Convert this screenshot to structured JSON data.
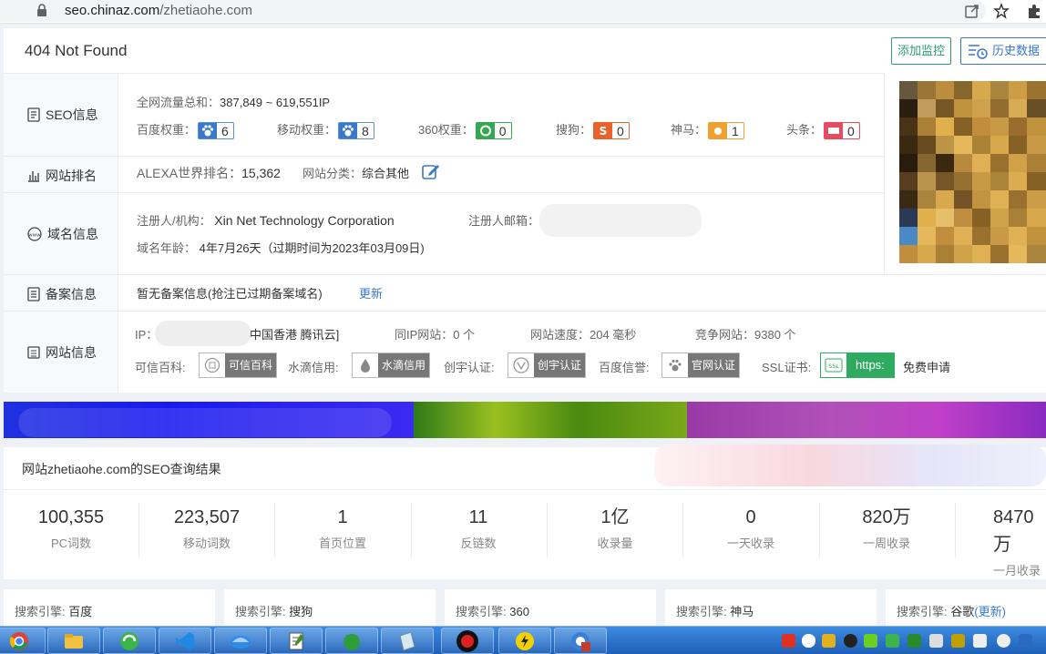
{
  "browser": {
    "url_host": "seo.chinaz.com",
    "url_path": "/zhetiaohe.com"
  },
  "header": {
    "title": "404 Not Found",
    "add_monitor": "添加监控",
    "history": "历史数据"
  },
  "seo": {
    "label": "SEO信息",
    "traffic_label": "全网流量总和：",
    "traffic_value": "387,849 ~ 619,551IP",
    "weights": [
      {
        "label": "百度权重：",
        "value": "6",
        "color": "#3a78c9"
      },
      {
        "label": "移动权重：",
        "value": "8",
        "color": "#3a78c9"
      },
      {
        "label": "360权重：",
        "value": "0",
        "color": "#34a853"
      },
      {
        "label": "搜狗：",
        "value": "0",
        "color": "#e8632b"
      },
      {
        "label": "神马：",
        "value": "1",
        "color": "#f0a030"
      },
      {
        "label": "头条：",
        "value": "0",
        "color": "#e84a5f"
      }
    ]
  },
  "ranking": {
    "label": "网站排名",
    "alexa_label": "ALEXA世界排名：",
    "alexa_value": "15,362",
    "category_label": "网站分类：",
    "category_value": "综合其他"
  },
  "domain": {
    "label": "域名信息",
    "registrant_label": "注册人/机构：",
    "registrant_value": "Xin Net Technology Corporation",
    "email_label": "注册人邮箱：",
    "age_label": "域名年龄：",
    "age_value": "4年7月26天（过期时间为2023年03月09日)"
  },
  "icp": {
    "label": "备案信息",
    "value": "暂无备案信息(抢注已过期备案域名)",
    "update": "更新"
  },
  "site": {
    "label": "网站信息",
    "ip_label": "IP：",
    "ip_location": "中国香港 腾讯云]",
    "same_ip": "同IP网站：0 个",
    "speed": "网站速度：204 毫秒",
    "competitors": "竞争网站：9380 个",
    "certs": [
      {
        "label": "可信百科:",
        "badge": "可信百科"
      },
      {
        "label": "水滴信用:",
        "badge": "水滴信用"
      },
      {
        "label": "创宇认证:",
        "badge": "创宇认证"
      },
      {
        "label": "百度信誉:",
        "badge": "官网认证"
      }
    ],
    "ssl_label": "SSL证书:",
    "ssl_badge": "https:",
    "ssl_link": "免费申请"
  },
  "results": {
    "title": "网站zhetiaohe.com的SEO查询结果",
    "stats": [
      {
        "value": "100,355",
        "label": "PC词数"
      },
      {
        "value": "223,507",
        "label": "移动词数"
      },
      {
        "value": "1",
        "label": "首页位置"
      },
      {
        "value": "11",
        "label": "反链数"
      },
      {
        "value": "1亿",
        "label": "收录量"
      },
      {
        "value": "0",
        "label": "一天收录"
      },
      {
        "value": "820万",
        "label": "一周收录"
      },
      {
        "value": "8470万",
        "label": "一月收录"
      }
    ]
  },
  "engines": {
    "prefix": "搜索引擎: ",
    "items": [
      "百度",
      "搜狗",
      "360",
      "神马",
      "谷歌"
    ],
    "update": "(更新)"
  }
}
